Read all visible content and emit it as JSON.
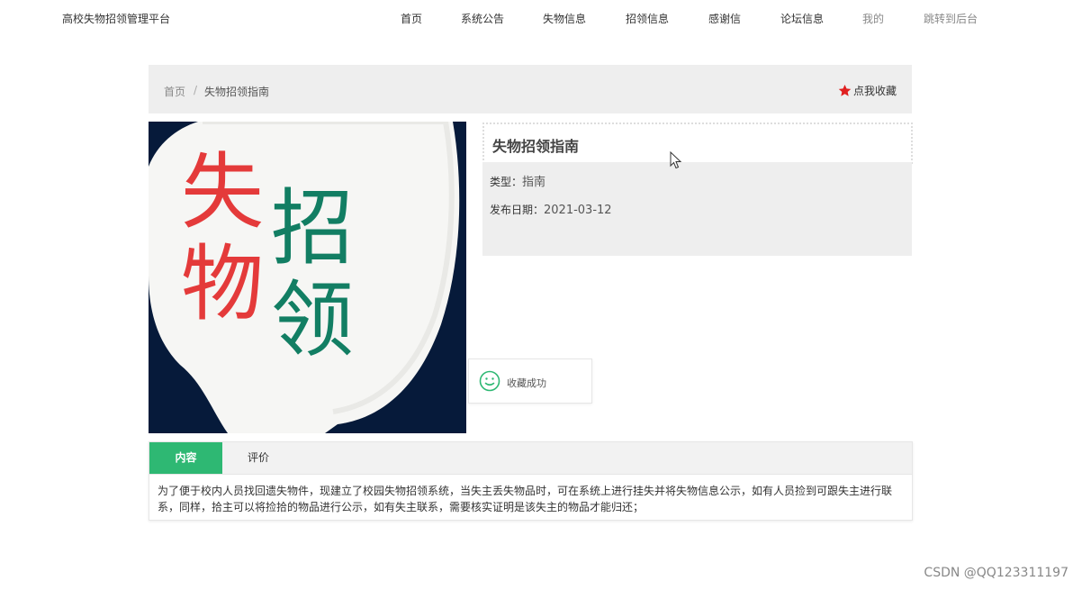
{
  "header": {
    "brand": "高校失物招领管理平台",
    "nav": [
      {
        "label": "首页",
        "muted": false
      },
      {
        "label": "系统公告",
        "muted": false
      },
      {
        "label": "失物信息",
        "muted": false
      },
      {
        "label": "招领信息",
        "muted": false
      },
      {
        "label": "感谢信",
        "muted": false
      },
      {
        "label": "论坛信息",
        "muted": false
      },
      {
        "label": "我的",
        "muted": true
      },
      {
        "label": "跳转到后台",
        "muted": true
      }
    ]
  },
  "breadcrumb": {
    "home": "首页",
    "separator": "/",
    "current": "失物招领指南"
  },
  "favorite": {
    "label": "点我收藏",
    "icon": "star-icon",
    "color": "#e02020"
  },
  "hero": {
    "chars": [
      "失",
      "物",
      "招",
      "领"
    ],
    "colors": {
      "red": "#e43a3a",
      "green": "#127e63",
      "navy": "#061a3a"
    }
  },
  "detail": {
    "title": "失物招领指南",
    "type_label": "类型：",
    "type_value": "指南",
    "date_label": "发布日期：",
    "date_value": "2021-03-12"
  },
  "toast": {
    "message": "收藏成功",
    "icon": "smile-icon"
  },
  "tabs": {
    "active": "内容",
    "other": "评价",
    "content": "为了便于校内人员找回遗失物件，现建立了校园失物招领系统，当失主丢失物品时，可在系统上进行挂失并将失物信息公示，如有人员捡到可跟失主进行联系，同样，拾主可以将捡拾的物品进行公示，如有失主联系，需要核实证明是该失主的物品才能归还；"
  },
  "watermark": "CSDN @QQ123311197",
  "accent": "#2eb873"
}
